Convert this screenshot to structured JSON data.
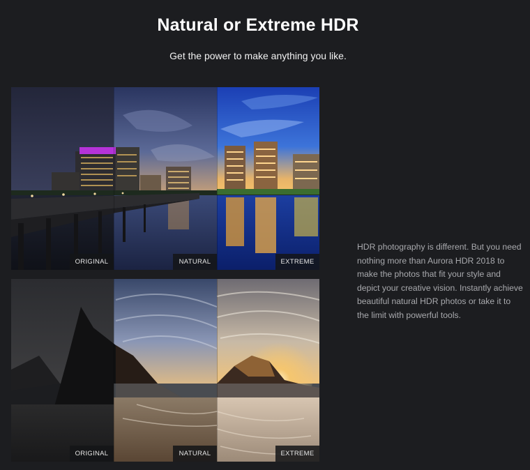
{
  "header": {
    "title": "Natural or Extreme HDR",
    "subtitle": "Get the power to make anything you like."
  },
  "comparisons": [
    {
      "subject": "city-waterfront",
      "labels": [
        "ORIGINAL",
        "NATURAL",
        "EXTREME"
      ]
    },
    {
      "subject": "beach-rocks",
      "labels": [
        "ORIGINAL",
        "NATURAL",
        "EXTREME"
      ]
    }
  ],
  "description": "HDR photography is different. But you need nothing more than Aurora HDR 2018 to make the photos that fit your style and depict your creative vision. Instantly achieve beautiful natural HDR photos or take it to the limit with powerful tools.",
  "colors": {
    "background": "#1c1d20",
    "text_muted": "#a8a9ad",
    "label_bg": "#141518"
  }
}
